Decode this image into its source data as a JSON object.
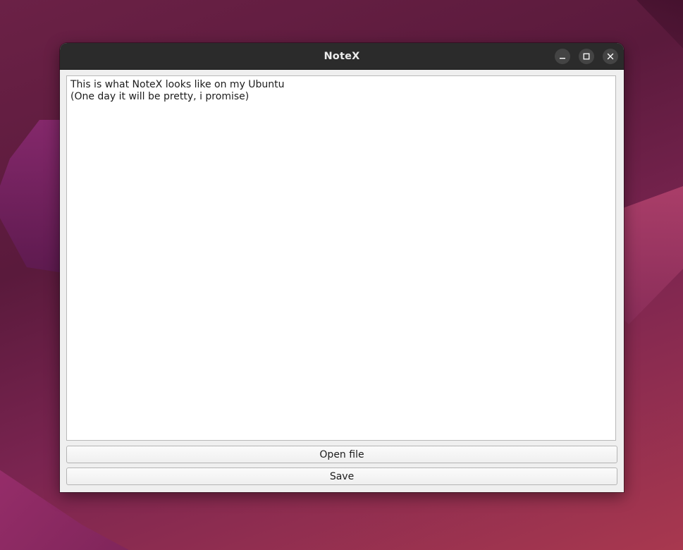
{
  "window": {
    "title": "NoteX",
    "controls": {
      "minimize_icon": "minimize-icon",
      "maximize_icon": "maximize-icon",
      "close_icon": "close-icon"
    }
  },
  "editor": {
    "content": "This is what NoteX looks like on my Ubuntu\n(One day it will be pretty, i promise)"
  },
  "buttons": {
    "open_label": "Open file",
    "save_label": "Save"
  },
  "colors": {
    "titlebar": "#2b2b2b",
    "window_bg": "#efefef",
    "editor_bg": "#ffffff"
  }
}
